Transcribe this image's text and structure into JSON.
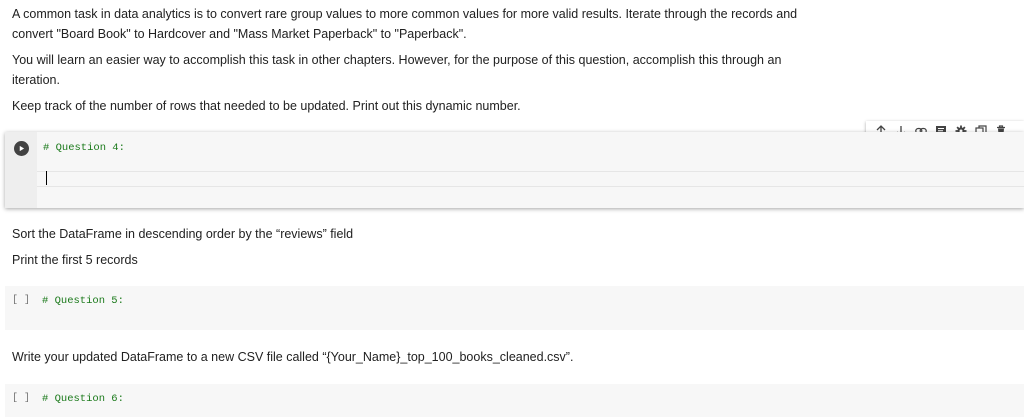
{
  "markdown": {
    "p1": "A common task in data analytics is to convert rare group values to more common values for more valid results. Iterate through the records and convert \"Board Book\" to Hardcover and \"Mass Market Paperback\" to \"Paperback\".",
    "p2": "You will learn an easier way to accomplish this task in other chapters. However, for the purpose of this question, accomplish this through an iteration.",
    "p3": "Keep track of the number of rows that needed to be updated. Print out this dynamic number.",
    "p4": "Sort the DataFrame in descending order by the “reviews” field",
    "p5": "Print the first 5 records",
    "p6": "Write your updated DataFrame to a new CSV file called “{Your_Name}_top_100_books_cleaned.csv”."
  },
  "cells": {
    "q4": {
      "code": "# Question 4:"
    },
    "q5": {
      "prompt": "[ ]",
      "code": "# Question 5:"
    },
    "q6": {
      "prompt": "[ ]",
      "code": "# Question 6:"
    }
  },
  "toolbar": {
    "icons": [
      "arrow-up-icon",
      "arrow-down-icon",
      "link-icon",
      "comment-icon",
      "settings-icon",
      "mirror-cell-icon",
      "delete-icon"
    ]
  }
}
